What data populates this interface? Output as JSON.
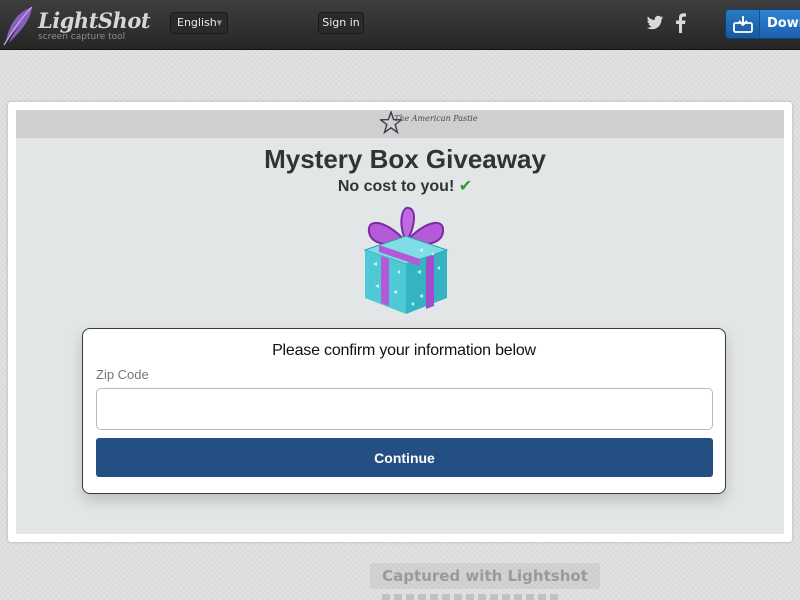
{
  "app": {
    "title": "LightShot",
    "subtitle": "screen capture tool",
    "language": "English",
    "signin_label": "Sign in",
    "download_label": "Download",
    "social": [
      "twitter-icon",
      "facebook-icon"
    ]
  },
  "capture": {
    "brand": "The American Pastie",
    "title": "Mystery Box Giveaway",
    "subtitle": "No cost to you!",
    "check_mark": "✔",
    "form": {
      "heading": "Please confirm your information below",
      "zip_label": "Zip Code",
      "zip_value": "",
      "button_label": "Continue"
    }
  },
  "footer": {
    "captured_label": "Captured with Lightshot"
  },
  "colors": {
    "topbar": "#2e2e2e",
    "download": "#2273c4",
    "continue": "#234f82",
    "check": "#2a9a28",
    "gift_box": "#4ec9d6",
    "gift_ribbon": "#b358d8"
  }
}
